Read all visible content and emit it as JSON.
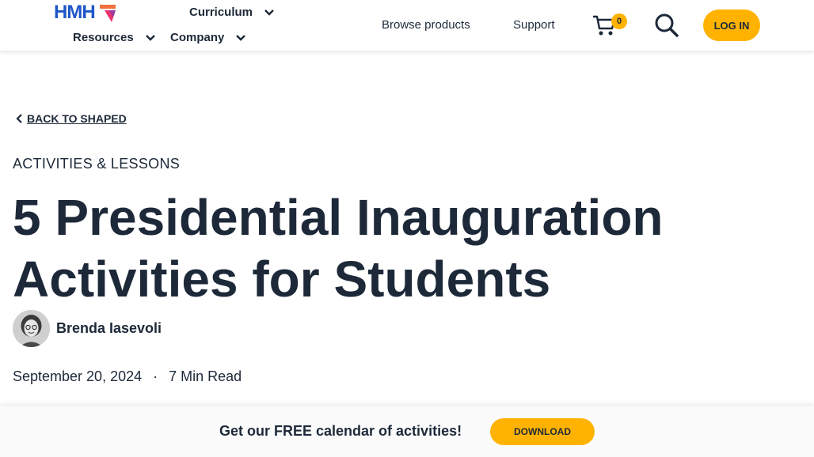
{
  "header": {
    "logo_text": "HMH",
    "nav": {
      "curriculum": "Curriculum",
      "resources": "Resources",
      "company": "Company"
    },
    "links": {
      "browse": "Browse products",
      "support": "Support"
    },
    "cart_count": "0",
    "login_label": "LOG IN"
  },
  "article": {
    "back_label": "BACK TO SHAPED",
    "category": "ACTIVITIES & LESSONS",
    "title": "5 Presidential Inauguration Activities for Students",
    "author": "Brenda Iasevoli",
    "date": "September 20, 2024",
    "separator": "·",
    "read_time": "7 Min Read"
  },
  "promo": {
    "text": "Get our FREE calendar of activities!",
    "button": "DOWNLOAD"
  },
  "colors": {
    "accent": "#ffb300",
    "brand": "#1f57c7",
    "text": "#1d2939"
  },
  "icons": [
    "chevron-down-icon",
    "cart-icon",
    "search-icon",
    "chevron-left-icon"
  ]
}
